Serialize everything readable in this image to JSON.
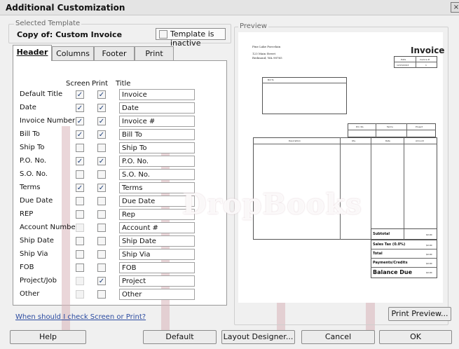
{
  "window": {
    "title": "Additional Customization",
    "close_glyph": "×"
  },
  "selected_template": {
    "legend": "Selected Template",
    "name": "Copy of: Custom Invoice",
    "inactive_label": "Template is inactive"
  },
  "tabs": [
    {
      "label": "Header",
      "active": true
    },
    {
      "label": "Columns",
      "active": false
    },
    {
      "label": "Footer",
      "active": false
    },
    {
      "label": "Print",
      "active": false
    }
  ],
  "columns": {
    "screen": "Screen",
    "print": "Print",
    "title": "Title"
  },
  "fields": [
    {
      "label": "Default Title",
      "screen": true,
      "print": true,
      "title": "Invoice"
    },
    {
      "label": "Date",
      "screen": true,
      "print": true,
      "title": "Date"
    },
    {
      "label": "Invoice Number",
      "screen": true,
      "print": true,
      "title": "Invoice #"
    },
    {
      "label": "Bill To",
      "screen": true,
      "print": true,
      "title": "Bill To"
    },
    {
      "label": "Ship To",
      "screen": false,
      "print": false,
      "title": "Ship To"
    },
    {
      "label": "P.O. No.",
      "screen": true,
      "print": true,
      "title": "P.O. No."
    },
    {
      "label": "S.O. No.",
      "screen": false,
      "print": false,
      "title": "S.O. No."
    },
    {
      "label": "Terms",
      "screen": true,
      "print": true,
      "title": "Terms"
    },
    {
      "label": "Due Date",
      "screen": false,
      "print": false,
      "title": "Due Date"
    },
    {
      "label": "REP",
      "screen": false,
      "print": false,
      "title": "Rep"
    },
    {
      "label": "Account Number",
      "screen": false,
      "print": false,
      "title": "Account #",
      "screen_disabled": true
    },
    {
      "label": "Ship Date",
      "screen": false,
      "print": false,
      "title": "Ship Date"
    },
    {
      "label": "Ship Via",
      "screen": false,
      "print": false,
      "title": "Ship Via"
    },
    {
      "label": "FOB",
      "screen": false,
      "print": false,
      "title": "FOB"
    },
    {
      "label": "Project/Job",
      "screen": false,
      "print": true,
      "title": "Project",
      "screen_disabled": true
    },
    {
      "label": "Other",
      "screen": false,
      "print": false,
      "title": "Other",
      "screen_disabled": true
    }
  ],
  "help_link": "When should I check Screen or Print?",
  "preview": {
    "legend": "Preview",
    "company_name": "Pine Lake Porcelain",
    "address_1": "123 Main Street",
    "address_2": "Redmond, WA 98765",
    "doc_title": "Invoice",
    "date_header": "Date",
    "invoice_header": "Invoice #",
    "date_value": "12/15/2013",
    "invoice_value": "1",
    "bill_to": "Bill To",
    "po_header": "P.O. No.",
    "terms_header": "Terms",
    "project_header": "Project",
    "description_header": "Description",
    "qty_header": "Qty",
    "rate_header": "Rate",
    "amount_header": "Amount",
    "subtotal": "Subtotal",
    "sales_tax": "Sales Tax (0.0%)",
    "total": "Total",
    "payments": "Payments/Credits",
    "balance": "Balance Due",
    "zero": "$0.00"
  },
  "buttons": {
    "print_preview": "Print Preview...",
    "help": "Help",
    "default": "Default",
    "layout_designer": "Layout Designer...",
    "cancel": "Cancel",
    "ok": "OK"
  },
  "watermark": {
    "text": "DropBooks"
  }
}
